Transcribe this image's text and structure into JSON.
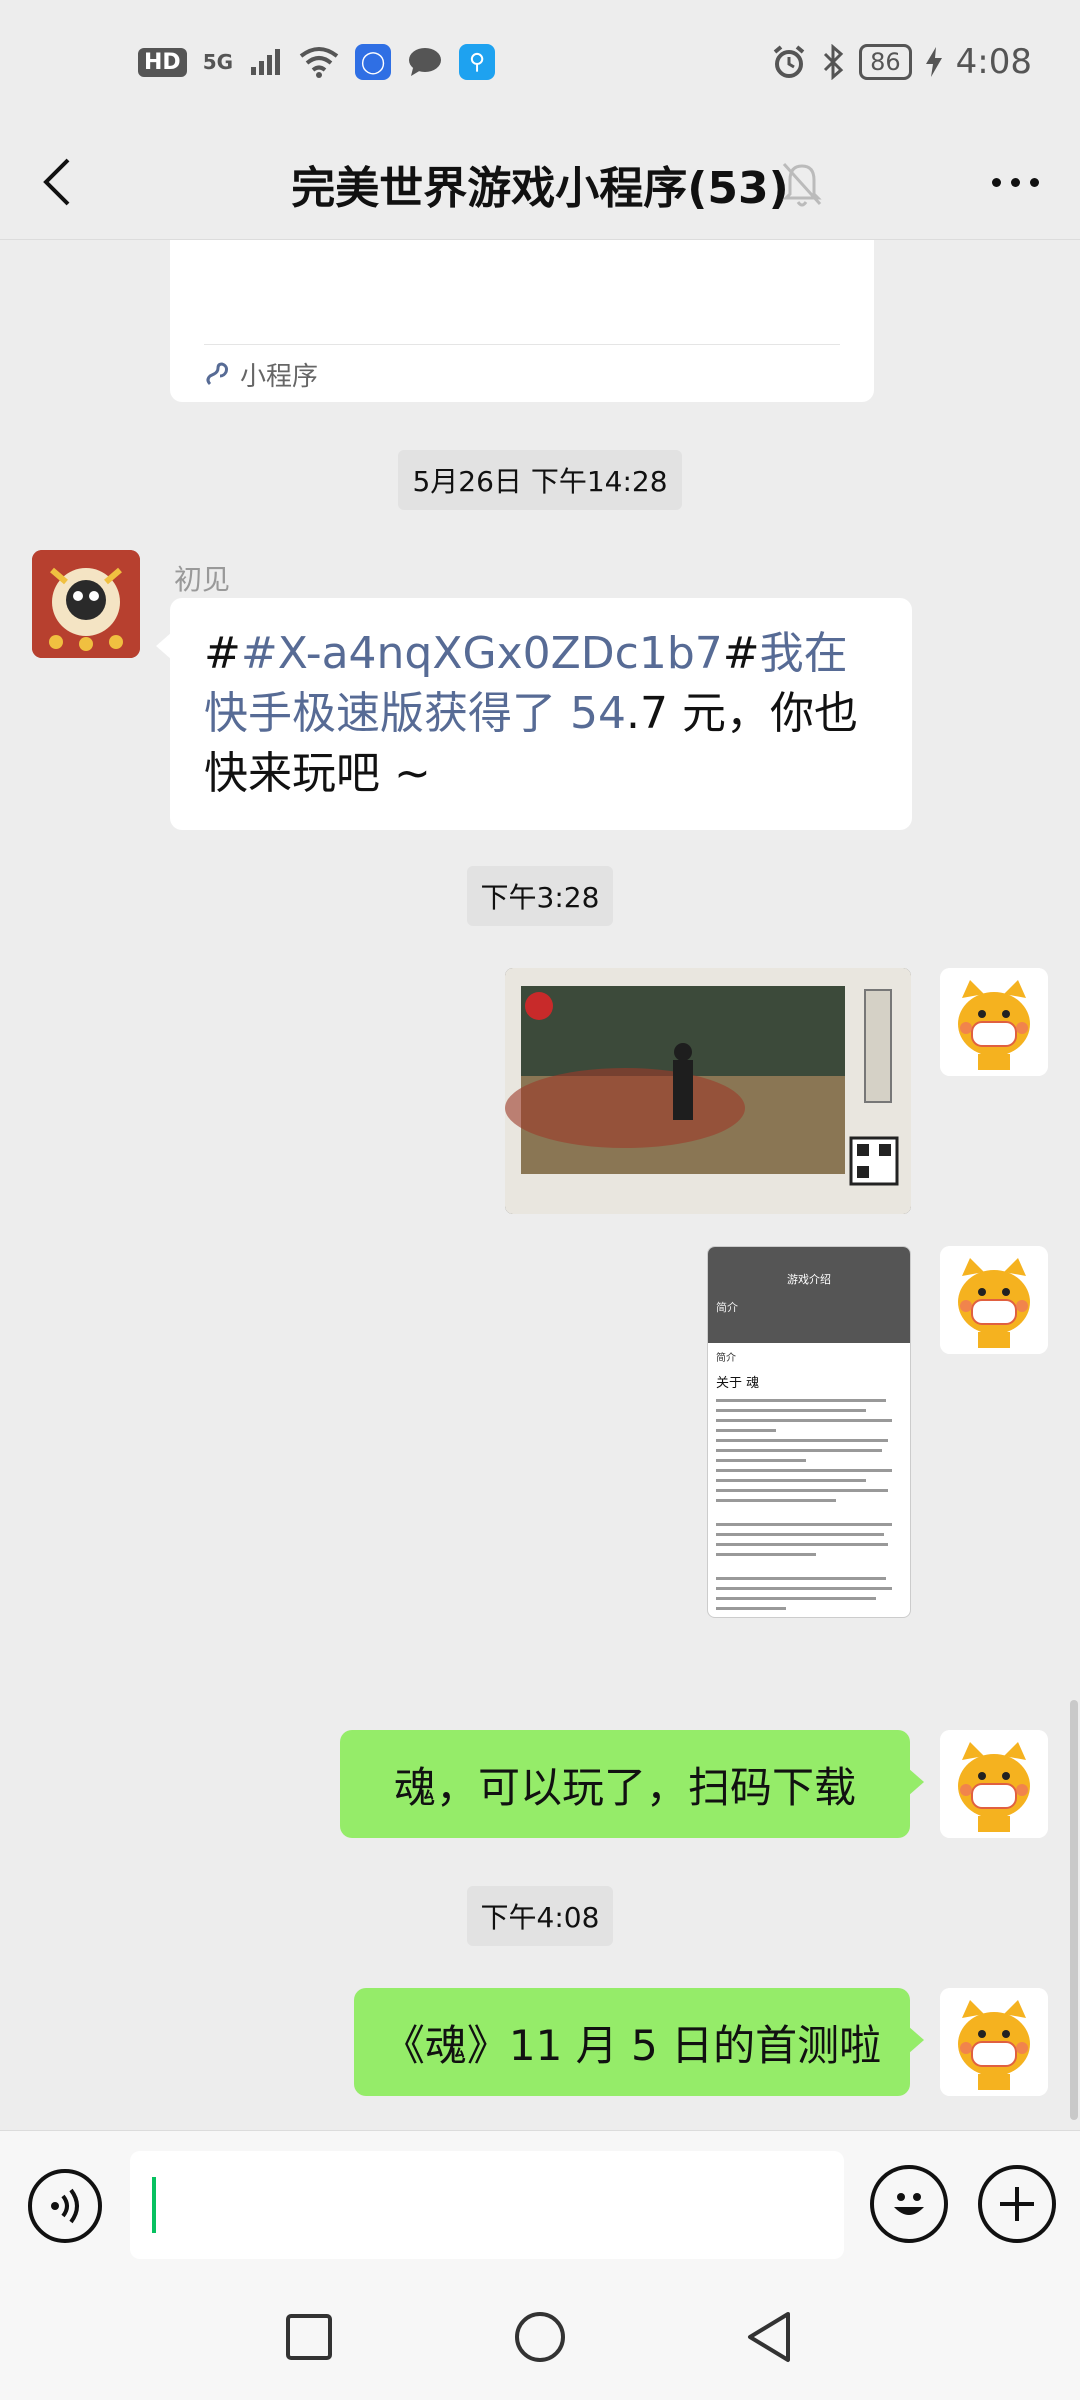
{
  "status_bar": {
    "hd": "HD",
    "network": "5G",
    "battery": "86",
    "time": "4:08"
  },
  "nav": {
    "title": "完美世界游戏小程序(53)"
  },
  "chat": {
    "mini_program_card": {
      "label": "小程序"
    },
    "timestamps": [
      "5月26日 下午14:28",
      "下午3:28",
      "下午4:08"
    ],
    "messages": {
      "incoming": {
        "sender": "初见",
        "link_part": "#X-a4nqXGx0ZDc1b7",
        "text_part_a": "#",
        "text_part_b": "我在快手极速版获得了",
        "text_amount": "54",
        "text_tail": ".7 元，你也快来玩吧 ~",
        "text_hash1": "#"
      },
      "outgoing_1": "魂，可以玩了，扫码下载",
      "outgoing_2": "《魂》11 月 5 日的首测啦",
      "screenshot_panel": {
        "header": "游戏介绍",
        "section": "简介",
        "heading": "关于 魂"
      }
    }
  },
  "input_bar": {
    "value": ""
  },
  "colors": {
    "accent_green": "#07c160",
    "bubble_green": "#95ec69",
    "link_blue": "#576b95"
  }
}
